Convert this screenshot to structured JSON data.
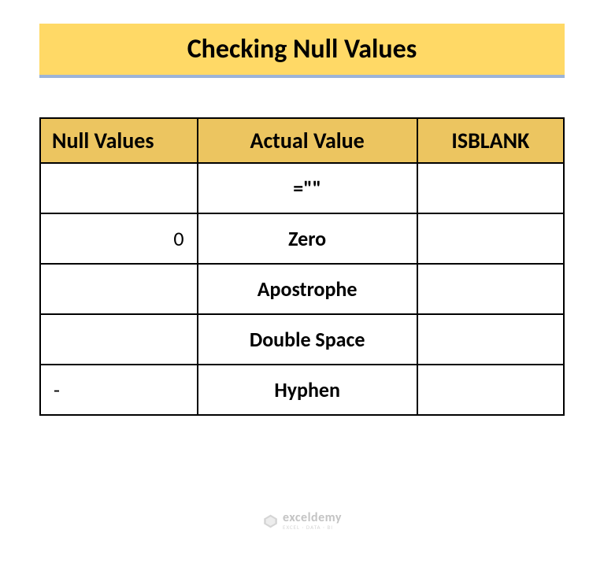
{
  "title": "Checking Null Values",
  "chart_data": {
    "type": "table",
    "headers": [
      "Null Values",
      "Actual Value",
      "ISBLANK"
    ],
    "rows": [
      {
        "null_value": "",
        "actual_value": "=\"\"",
        "isblank": ""
      },
      {
        "null_value": "0",
        "actual_value": "Zero",
        "isblank": ""
      },
      {
        "null_value": "",
        "actual_value": "Apostrophe",
        "isblank": ""
      },
      {
        "null_value": "",
        "actual_value": "Double Space",
        "isblank": ""
      },
      {
        "null_value": "-",
        "actual_value": "Hyphen",
        "isblank": ""
      }
    ]
  },
  "watermark": {
    "main": "exceldemy",
    "sub": "EXCEL · DATA · BI"
  }
}
